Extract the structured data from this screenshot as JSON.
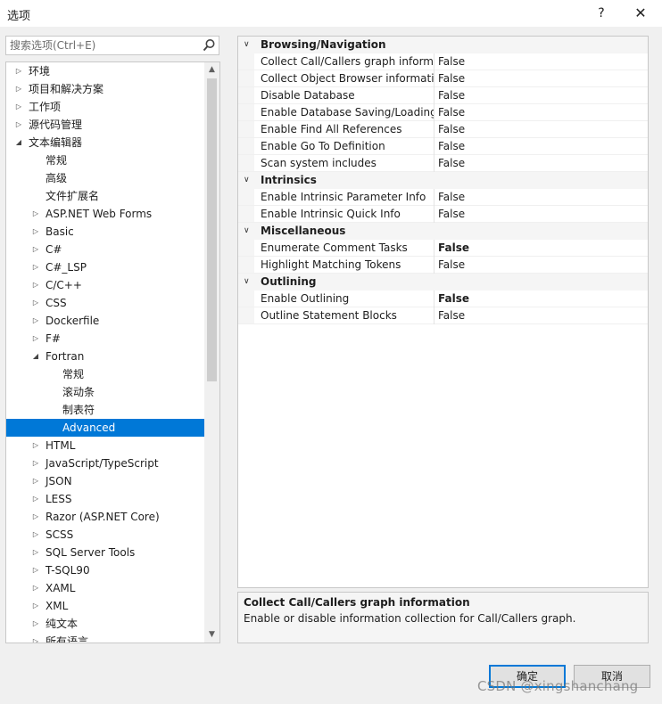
{
  "window": {
    "title": "选项",
    "help_label": "?",
    "close_label": "✕"
  },
  "search": {
    "placeholder": "搜索选项(Ctrl+E)",
    "icon": "search-icon"
  },
  "tree": {
    "items": [
      {
        "label": "环境",
        "level": 0,
        "state": "collapsed"
      },
      {
        "label": "项目和解决方案",
        "level": 0,
        "state": "collapsed"
      },
      {
        "label": "工作项",
        "level": 0,
        "state": "collapsed"
      },
      {
        "label": "源代码管理",
        "level": 0,
        "state": "collapsed"
      },
      {
        "label": "文本编辑器",
        "level": 0,
        "state": "expanded"
      },
      {
        "label": "常规",
        "level": 1,
        "state": "leaf"
      },
      {
        "label": "高级",
        "level": 1,
        "state": "leaf"
      },
      {
        "label": "文件扩展名",
        "level": 1,
        "state": "leaf"
      },
      {
        "label": "ASP.NET Web Forms",
        "level": 1,
        "state": "collapsed"
      },
      {
        "label": "Basic",
        "level": 1,
        "state": "collapsed"
      },
      {
        "label": "C#",
        "level": 1,
        "state": "collapsed"
      },
      {
        "label": "C#_LSP",
        "level": 1,
        "state": "collapsed"
      },
      {
        "label": "C/C++",
        "level": 1,
        "state": "collapsed"
      },
      {
        "label": "CSS",
        "level": 1,
        "state": "collapsed"
      },
      {
        "label": "Dockerfile",
        "level": 1,
        "state": "collapsed"
      },
      {
        "label": "F#",
        "level": 1,
        "state": "collapsed"
      },
      {
        "label": "Fortran",
        "level": 1,
        "state": "expanded"
      },
      {
        "label": "常规",
        "level": 2,
        "state": "leaf"
      },
      {
        "label": "滚动条",
        "level": 2,
        "state": "leaf"
      },
      {
        "label": "制表符",
        "level": 2,
        "state": "leaf"
      },
      {
        "label": "Advanced",
        "level": 2,
        "state": "leaf",
        "selected": true
      },
      {
        "label": "HTML",
        "level": 1,
        "state": "collapsed"
      },
      {
        "label": "JavaScript/TypeScript",
        "level": 1,
        "state": "collapsed"
      },
      {
        "label": "JSON",
        "level": 1,
        "state": "collapsed"
      },
      {
        "label": "LESS",
        "level": 1,
        "state": "collapsed"
      },
      {
        "label": "Razor (ASP.NET Core)",
        "level": 1,
        "state": "collapsed"
      },
      {
        "label": "SCSS",
        "level": 1,
        "state": "collapsed"
      },
      {
        "label": "SQL Server Tools",
        "level": 1,
        "state": "collapsed"
      },
      {
        "label": "T-SQL90",
        "level": 1,
        "state": "collapsed"
      },
      {
        "label": "XAML",
        "level": 1,
        "state": "collapsed"
      },
      {
        "label": "XML",
        "level": 1,
        "state": "collapsed"
      },
      {
        "label": "纯文本",
        "level": 1,
        "state": "collapsed"
      },
      {
        "label": "所有语言",
        "level": 1,
        "state": "collapsed"
      }
    ]
  },
  "properties": {
    "categories": [
      {
        "name": "Browsing/Navigation",
        "rows": [
          {
            "name": "Collect Call/Callers graph information",
            "value": "False",
            "bold": false
          },
          {
            "name": "Collect Object Browser information",
            "value": "False",
            "bold": false
          },
          {
            "name": "Disable Database",
            "value": "False",
            "bold": false
          },
          {
            "name": "Enable Database Saving/Loading",
            "value": "False",
            "bold": false
          },
          {
            "name": "Enable Find All References",
            "value": "False",
            "bold": false
          },
          {
            "name": "Enable Go To Definition",
            "value": "False",
            "bold": false
          },
          {
            "name": "Scan system includes",
            "value": "False",
            "bold": false
          }
        ]
      },
      {
        "name": "Intrinsics",
        "rows": [
          {
            "name": "Enable Intrinsic Parameter Info",
            "value": "False",
            "bold": false
          },
          {
            "name": "Enable Intrinsic Quick Info",
            "value": "False",
            "bold": false
          }
        ]
      },
      {
        "name": "Miscellaneous",
        "rows": [
          {
            "name": "Enumerate Comment Tasks",
            "value": "False",
            "bold": true
          },
          {
            "name": "Highlight Matching Tokens",
            "value": "False",
            "bold": false
          }
        ]
      },
      {
        "name": "Outlining",
        "rows": [
          {
            "name": "Enable Outlining",
            "value": "False",
            "bold": true
          },
          {
            "name": "Outline Statement Blocks",
            "value": "False",
            "bold": false
          }
        ]
      }
    ]
  },
  "description": {
    "title": "Collect Call/Callers graph information",
    "text": "Enable or disable information collection for Call/Callers graph."
  },
  "buttons": {
    "ok": "确定",
    "cancel": "取消"
  },
  "watermark": "CSDN @xingshanchang",
  "colors": {
    "selection": "#0078d7",
    "panel_border": "#c8c8c8",
    "dialog_bg": "#f0f0f0"
  }
}
